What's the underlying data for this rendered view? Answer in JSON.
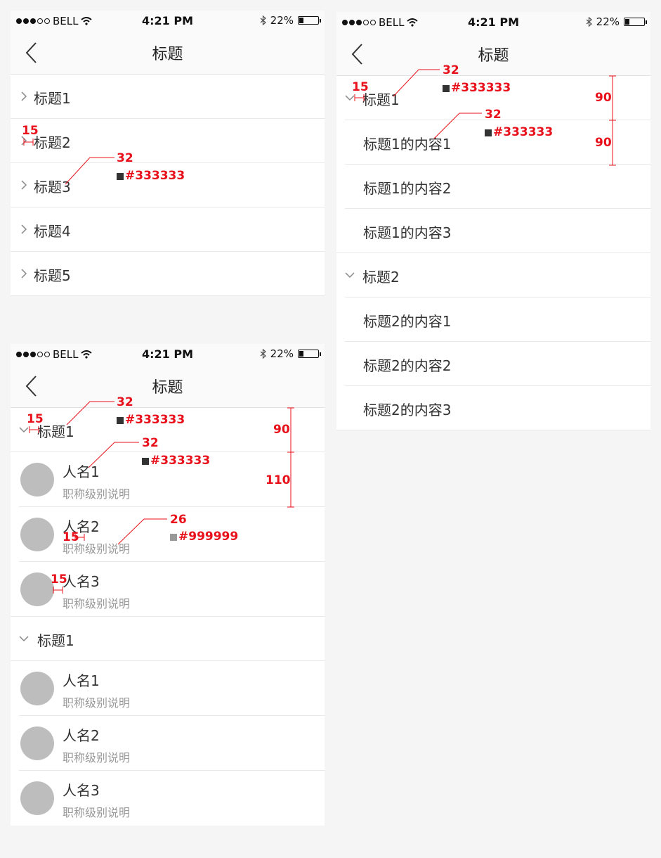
{
  "status": {
    "carrier": "BELL",
    "time": "4:21 PM",
    "battery": "22%"
  },
  "nav": {
    "title": "标题"
  },
  "screen1": {
    "items": [
      "标题1",
      "标题2",
      "标题3",
      "标题4",
      "标题5"
    ]
  },
  "screen2": {
    "groups": [
      {
        "title": "标题1",
        "items": [
          "标题1的内容1",
          "标题1的内容2",
          "标题1的内容3"
        ]
      },
      {
        "title": "标题2",
        "items": [
          "标题2的内容1",
          "标题2的内容2",
          "标题2的内容3"
        ]
      }
    ]
  },
  "screen3": {
    "groups": [
      {
        "title": "标题1",
        "people": [
          {
            "name": "人名1",
            "job": "职称级别说明"
          },
          {
            "name": "人名2",
            "job": "职称级别说明"
          },
          {
            "name": "人名3",
            "job": "职称级别说明"
          }
        ]
      },
      {
        "title": "标题1",
        "people": [
          {
            "name": "人名1",
            "job": "职称级别说明"
          },
          {
            "name": "人名2",
            "job": "职称级别说明"
          },
          {
            "name": "人名3",
            "job": "职称级别说明"
          }
        ]
      }
    ]
  },
  "annotations": {
    "a15": "15",
    "a32": "32",
    "a26": "26",
    "a90": "90",
    "a110": "110",
    "c333": "#333333",
    "c999": "#999999"
  },
  "colors": {
    "annotation": "#e8101a",
    "text_main": "#333333",
    "text_sub": "#999999",
    "avatar": "#bdbdbd"
  }
}
